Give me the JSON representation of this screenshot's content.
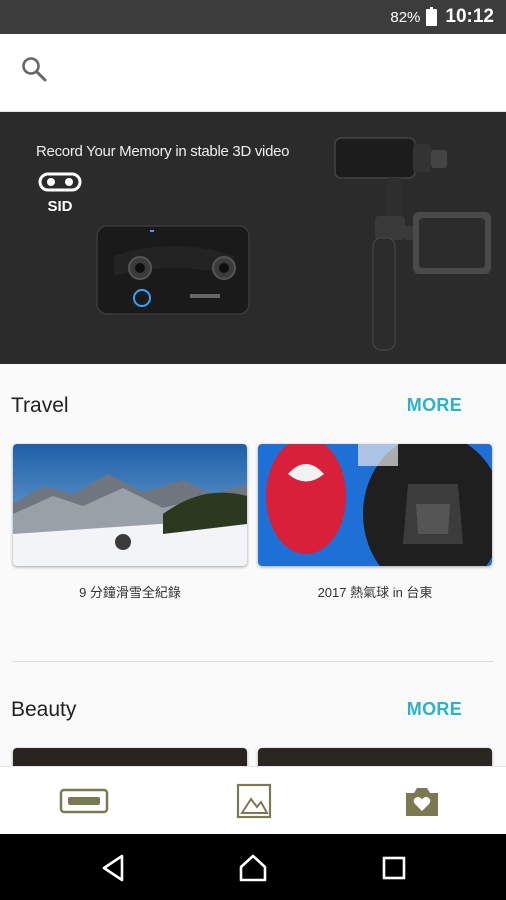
{
  "status_bar": {
    "battery": "82%",
    "time": "10:12"
  },
  "search": {
    "icon": "search-icon"
  },
  "banner": {
    "headline": "Record Your Memory in stable 3D video",
    "logo_text": "SID"
  },
  "sections": [
    {
      "title": "Travel",
      "more_label": "MORE",
      "items": [
        {
          "caption": "9 分鐘滑雪全紀錄",
          "thumb": "snowy-mountains"
        },
        {
          "caption": "2017 熱氣球 in 台東",
          "thumb": "hot-air-balloons"
        }
      ]
    },
    {
      "title": "Beauty",
      "more_label": "MORE",
      "items": []
    }
  ],
  "bottom_tabs": [
    {
      "icon": "vr-headset-icon",
      "active": false
    },
    {
      "icon": "gallery-icon",
      "active": false
    },
    {
      "icon": "camera-heart-icon",
      "active": true
    }
  ],
  "nav_bar": [
    "back-icon",
    "home-icon",
    "recents-icon"
  ],
  "colors": {
    "accent": "#2bb3c6",
    "tab_icon": "#7a7a52",
    "banner_bg": "#2b2b2b"
  }
}
